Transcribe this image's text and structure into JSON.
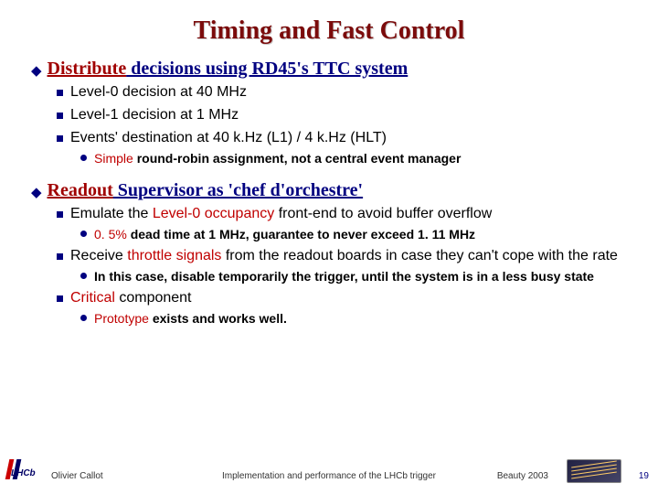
{
  "title": "Timing and Fast Control",
  "section1": {
    "head_a": "Distribute",
    "head_b": " decisions using RD45's TTC system",
    "items": [
      "Level-0 decision at 40 MHz",
      "Level-1 decision at 1 MHz",
      "Events' destination at 40 k.Hz (L1) / 4 k.Hz (HLT)"
    ],
    "sub1": {
      "a": "Simple ",
      "b": "round-robin assignment, not a central event manager"
    }
  },
  "section2": {
    "head_a": "Readout",
    "head_b": " Supervisor as 'chef d'orchestre'",
    "item1_a": "Emulate the ",
    "item1_b": "Level-0 occupancy",
    "item1_c": " front-end to avoid buffer overflow",
    "sub1_a": "0. 5% ",
    "sub1_b": "dead time at 1 MHz, guarantee to never exceed 1. 11 MHz",
    "item2_a": "Receive ",
    "item2_b": "throttle signals ",
    "item2_c": "from the readout boards in case they can't cope with the rate",
    "sub2": "In this case, disable temporarily the trigger, until the system is in a less busy state",
    "item3_a": "Critical",
    "item3_b": " component",
    "sub3_a": "Prototype ",
    "sub3_b": "exists and works well."
  },
  "footer": {
    "author": "Olivier Callot",
    "center": "Implementation and performance of the LHCb trigger",
    "conf": "Beauty 2003",
    "page": "19",
    "left_logo_text": "LHCb"
  }
}
